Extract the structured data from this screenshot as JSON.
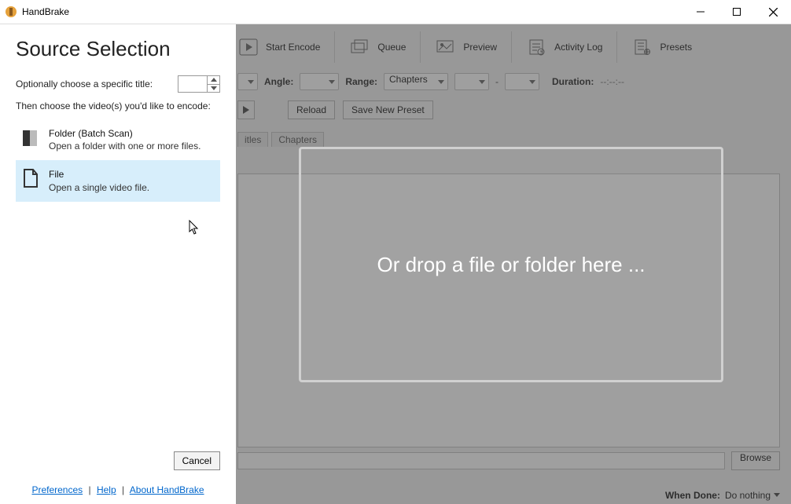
{
  "window": {
    "title": "HandBrake"
  },
  "toolbar": {
    "start": "Start Encode",
    "queue": "Queue",
    "preview": "Preview",
    "activity": "Activity Log",
    "presets": "Presets"
  },
  "optrow": {
    "angle": "Angle:",
    "range": "Range:",
    "range_value": "Chapters",
    "dash": "-",
    "duration_label": "Duration:",
    "duration_value": "--:--:--"
  },
  "secrow": {
    "reload": "Reload",
    "save_preset": "Save New Preset"
  },
  "tabs": {
    "titles": "itles",
    "chapters": "Chapters"
  },
  "browse": {
    "label": "Browse"
  },
  "statusbar": {
    "when_done_label": "When Done:",
    "when_done_value": "Do nothing"
  },
  "drop": {
    "text": "Or drop a file or folder here ..."
  },
  "panel": {
    "heading": "Source Selection",
    "title_hint": "Optionally choose a specific title:",
    "encode_hint": "Then choose the video(s) you'd like to encode:",
    "folder": {
      "title": "Folder (Batch Scan)",
      "desc": "Open a folder with one or more files."
    },
    "file": {
      "title": "File",
      "desc": "Open a single video file."
    },
    "cancel": "Cancel",
    "links": {
      "prefs": "Preferences",
      "help": "Help",
      "about": "About HandBrake"
    }
  }
}
